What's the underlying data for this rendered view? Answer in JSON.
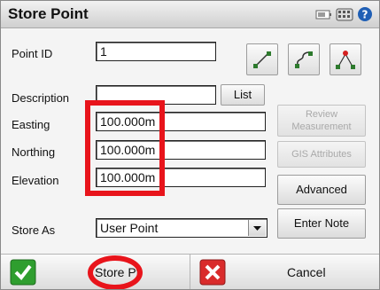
{
  "window": {
    "title": "Store Point"
  },
  "titlebar_icons": [
    "battery-icon",
    "keyboard-icon",
    "help-icon"
  ],
  "form": {
    "point_id_label": "Point ID",
    "point_id_value": "1",
    "description_label": "Description",
    "description_value": "",
    "list_button": "List",
    "easting_label": "Easting",
    "easting_value": "100.000m",
    "northing_label": "Northing",
    "northing_value": "100.000m",
    "elevation_label": "Elevation",
    "elevation_value": "100.000m",
    "store_as_label": "Store As",
    "store_as_value": "User Point"
  },
  "side_buttons": {
    "review_measurement_line1": "Review",
    "review_measurement_line2": "Measurement",
    "gis_attributes": "GIS Attributes",
    "advanced": "Advanced",
    "enter_note": "Enter Note"
  },
  "bottom": {
    "store_point": "Store Pt",
    "cancel": "Cancel"
  },
  "colors": {
    "highlight_red": "#e8141b",
    "accept_green": "#2f9e2f",
    "cancel_red": "#d92b2b"
  }
}
